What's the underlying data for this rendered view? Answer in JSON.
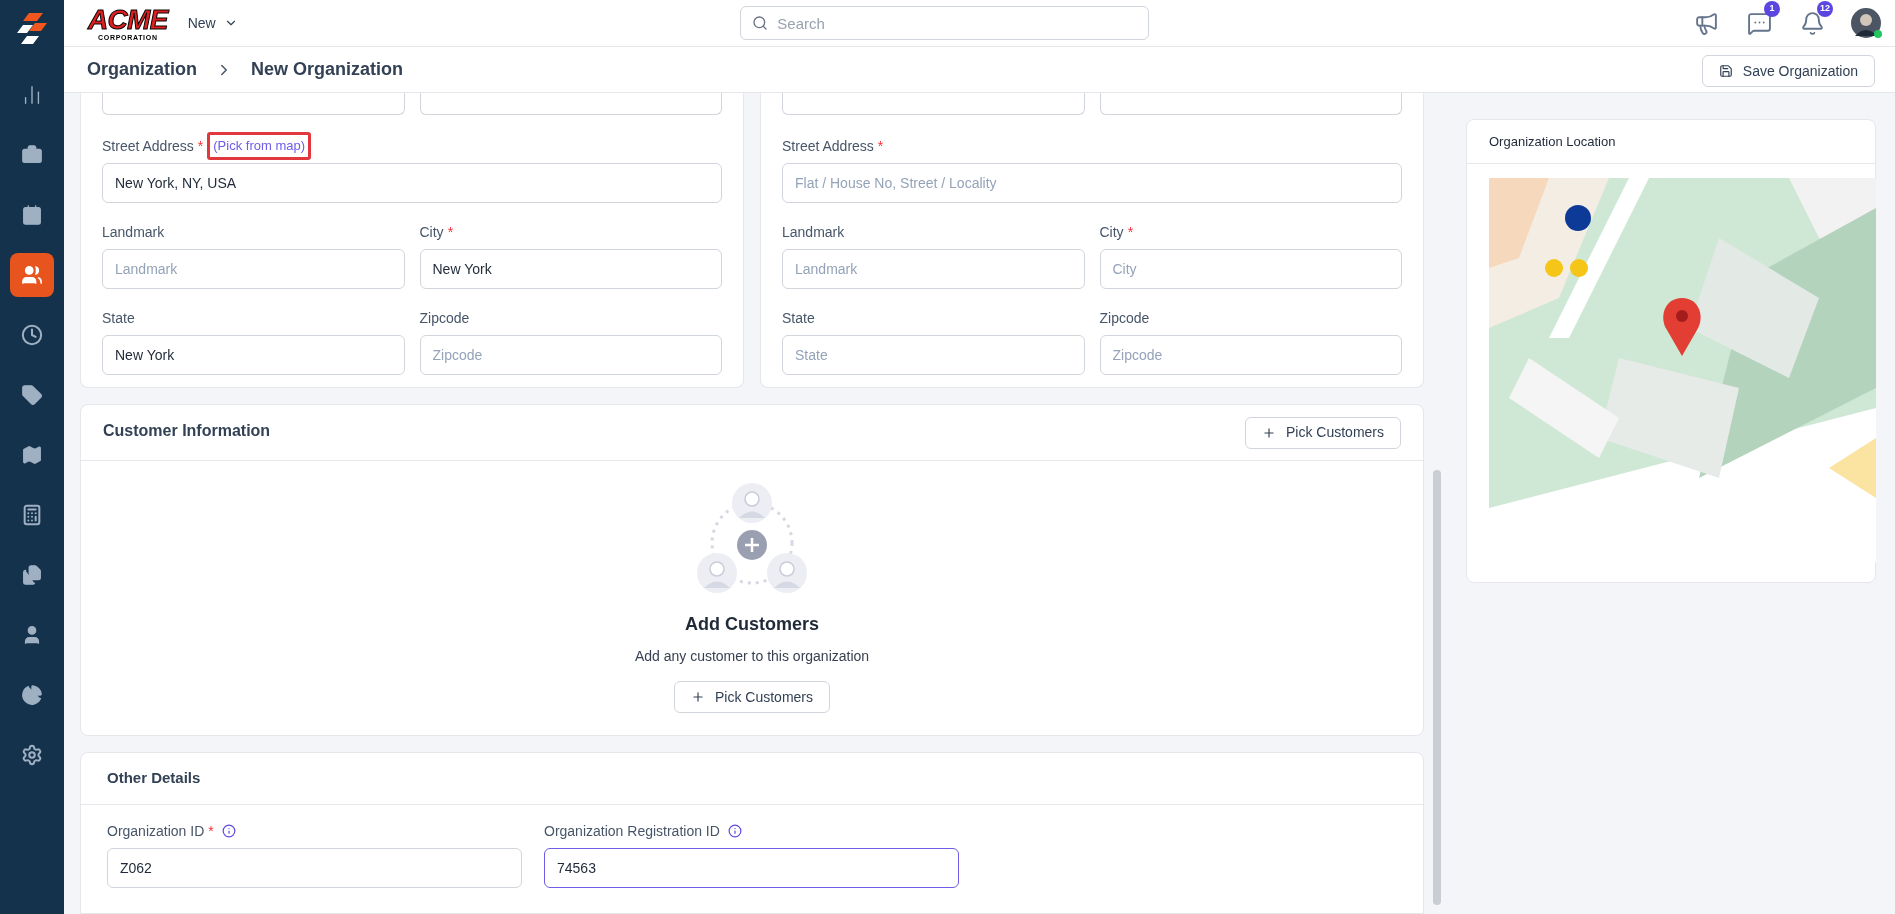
{
  "sidebar": {
    "items": [
      {
        "selected": false
      },
      {
        "selected": false
      },
      {
        "selected": false
      },
      {
        "selected": true
      },
      {
        "selected": false
      },
      {
        "selected": false
      },
      {
        "selected": false
      },
      {
        "selected": false
      },
      {
        "selected": false
      },
      {
        "selected": false
      },
      {
        "selected": false
      },
      {
        "selected": false
      }
    ]
  },
  "header": {
    "logo": {
      "title": "ACME",
      "subtitle": "CORPORATION"
    },
    "menu": {
      "label": "New"
    },
    "search": {
      "placeholder": "Search"
    },
    "icons": [
      {
        "kind": "announcements"
      },
      {
        "kind": "messages",
        "badge": "1"
      },
      {
        "kind": "notifications",
        "badge": "12"
      }
    ],
    "avatar": {
      "online": true
    }
  },
  "breadcrumb": [
    "Organization",
    "New Organization"
  ],
  "save_button": "Save Organization",
  "address_cards": [
    {
      "fields": [
        {
          "label": "Street Address",
          "required_mark": "*",
          "value": "New York, NY, USA",
          "link": {
            "text": "(Pick from map)",
            "highlighted": true
          }
        },
        {
          "label": "Landmark",
          "placeholder": "Landmark"
        },
        {
          "label": "City",
          "required_mark": "*",
          "value": "New York"
        },
        {
          "label": "State",
          "value": "New York"
        },
        {
          "label": "Zipcode",
          "placeholder": "Zipcode"
        }
      ]
    },
    {
      "fields": [
        {
          "label": "Street Address",
          "required_mark": "*",
          "placeholder": "Flat / House No, Street / Locality"
        },
        {
          "label": "Landmark",
          "placeholder": "Landmark"
        },
        {
          "label": "City",
          "required_mark": "*",
          "placeholder": "City"
        },
        {
          "label": "State",
          "placeholder": "State"
        },
        {
          "label": "Zipcode",
          "placeholder": "Zipcode"
        }
      ]
    }
  ],
  "customer_info": {
    "title": "Customer Information",
    "button": "Pick Customers",
    "empty": {
      "title": "Add Customers",
      "text": "Add any customer to this organization",
      "button": "Pick Customers"
    }
  },
  "other_details": {
    "title": "Other Details",
    "fields": [
      {
        "label": "Organization ID",
        "required_mark": "*",
        "info": true,
        "value": "Z062",
        "focused": false
      },
      {
        "label": "Organization Registration ID",
        "info": true,
        "value": "74563",
        "focused": true
      }
    ]
  },
  "location": {
    "title": "Organization Location"
  }
}
